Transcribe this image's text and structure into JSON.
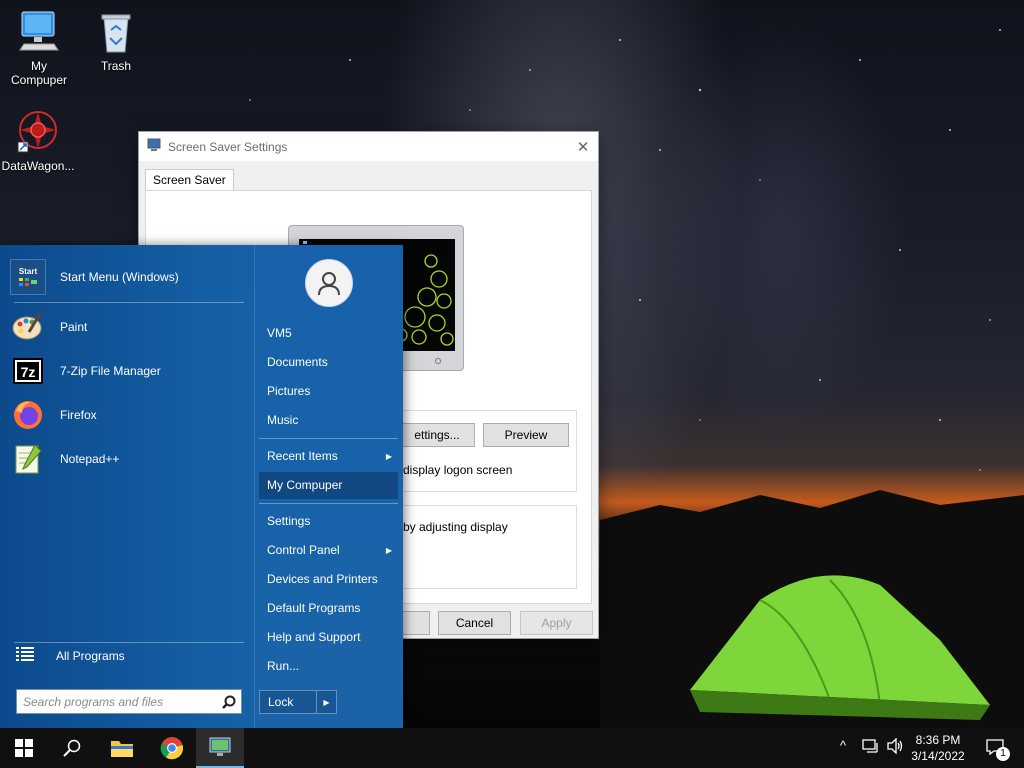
{
  "desktop": {
    "icons": [
      {
        "label": "My\nCompuper",
        "icon": "computer-icon"
      },
      {
        "label": "Trash",
        "icon": "recycle-bin-icon"
      },
      {
        "label": "DataWagon...",
        "icon": "datawagon-app-icon"
      }
    ]
  },
  "dialog": {
    "title": "Screen Saver Settings",
    "tab": "Screen Saver",
    "settings_label": "ettings...",
    "preview_label": "Preview",
    "logon_text": "display logon screen",
    "power_text": "by adjusting display",
    "ok_label": "",
    "cancel_label": "Cancel",
    "apply_label": "Apply"
  },
  "start_menu": {
    "header_label": "Start Menu (Windows)",
    "header_icon_text": "Start",
    "pinned": [
      {
        "label": "Paint",
        "icon": "paint-icon"
      },
      {
        "label": "7-Zip File Manager",
        "icon": "7zip-icon"
      },
      {
        "label": "Firefox",
        "icon": "firefox-icon"
      },
      {
        "label": "Notepad++",
        "icon": "notepadpp-icon"
      }
    ],
    "all_programs": "All Programs",
    "search_placeholder": "Search programs and files",
    "right": {
      "user": "VM5",
      "documents": "Documents",
      "pictures": "Pictures",
      "music": "Music",
      "recent_items": "Recent Items",
      "my_computer": "My Compuper",
      "settings": "Settings",
      "control_panel": "Control Panel",
      "devices_printers": "Devices and Printers",
      "default_programs": "Default Programs",
      "help_support": "Help and Support",
      "run": "Run..."
    },
    "lock_label": "Lock"
  },
  "taskbar": {
    "time": "8:36 PM",
    "date": "3/14/2022",
    "notification_count": "1"
  },
  "colors": {
    "start_menu_bg": "#1560a5",
    "taskbar_bg": "#101010",
    "active_accent": "#76b9ed"
  }
}
